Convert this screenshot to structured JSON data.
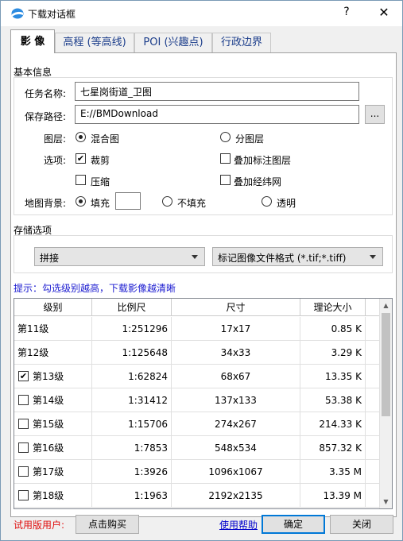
{
  "window": {
    "title": "下载对话框",
    "help_glyph": "?",
    "close_glyph": "✕"
  },
  "tabs": [
    {
      "label": "影 像",
      "active": true
    },
    {
      "label": "高程 (等高线)",
      "active": false
    },
    {
      "label": "POI (兴趣点)",
      "active": false
    },
    {
      "label": "行政边界",
      "active": false
    }
  ],
  "basic": {
    "section_title": "基本信息",
    "task_name_label": "任务名称:",
    "task_name_value": "七星岗街道_卫图",
    "save_path_label": "保存路径:",
    "save_path_value": "E://BMDownload",
    "browse_label": "...",
    "layer_label": "图层:",
    "layer_options": [
      {
        "label": "混合图",
        "selected": true
      },
      {
        "label": "分图层",
        "selected": false
      }
    ],
    "options_label": "选项:",
    "checks": [
      {
        "label": "裁剪",
        "checked": true
      },
      {
        "label": "叠加标注图层",
        "checked": false
      },
      {
        "label": "压缩",
        "checked": false
      },
      {
        "label": "叠加经纬网",
        "checked": false
      }
    ],
    "bg_label": "地图背景:",
    "bg_options": [
      {
        "label": "填充",
        "selected": true
      },
      {
        "label": "不填充",
        "selected": false
      },
      {
        "label": "透明",
        "selected": false
      }
    ]
  },
  "storage": {
    "section_title": "存储选项",
    "mode_value": "拼接",
    "format_value": "标记图像文件格式 (*.tif;*.tiff)"
  },
  "hint": "提示：勾选级别越高，下载影像越清晰",
  "table": {
    "headers": [
      "级别",
      "比例尺",
      "尺寸",
      "理论大小"
    ],
    "rows": [
      {
        "level": "第11级",
        "scale": "1:251296",
        "size": "17x17",
        "bytes": "0.85 K",
        "checkbox": false,
        "checked": false
      },
      {
        "level": "第12级",
        "scale": "1:125648",
        "size": "34x33",
        "bytes": "3.29 K",
        "checkbox": false,
        "checked": false
      },
      {
        "level": "第13级",
        "scale": "1:62824",
        "size": "68x67",
        "bytes": "13.35 K",
        "checkbox": true,
        "checked": true
      },
      {
        "level": "第14级",
        "scale": "1:31412",
        "size": "137x133",
        "bytes": "53.38 K",
        "checkbox": true,
        "checked": false
      },
      {
        "level": "第15级",
        "scale": "1:15706",
        "size": "274x267",
        "bytes": "214.33 K",
        "checkbox": true,
        "checked": false
      },
      {
        "level": "第16级",
        "scale": "1:7853",
        "size": "548x534",
        "bytes": "857.32 K",
        "checkbox": true,
        "checked": false
      },
      {
        "level": "第17级",
        "scale": "1:3926",
        "size": "1096x1067",
        "bytes": "3.35 M",
        "checkbox": true,
        "checked": false
      },
      {
        "level": "第18级",
        "scale": "1:1963",
        "size": "2192x2135",
        "bytes": "13.39 M",
        "checkbox": true,
        "checked": false
      }
    ]
  },
  "footer": {
    "trial_label": "试用版用户:",
    "buy_label": "点击购买",
    "help_link": "使用帮助",
    "ok_label": "确定",
    "close_label": "关闭"
  },
  "colors": {
    "hint": "#1a1ad0",
    "trial": "#e01010",
    "link": "#0000cc",
    "tab_text": "#1a3c8a"
  },
  "icons": {
    "app": "map-logo-icon",
    "combo": "chevron-down-icon",
    "scroll_up": "chevron-up-icon",
    "scroll_down": "chevron-down-icon"
  }
}
